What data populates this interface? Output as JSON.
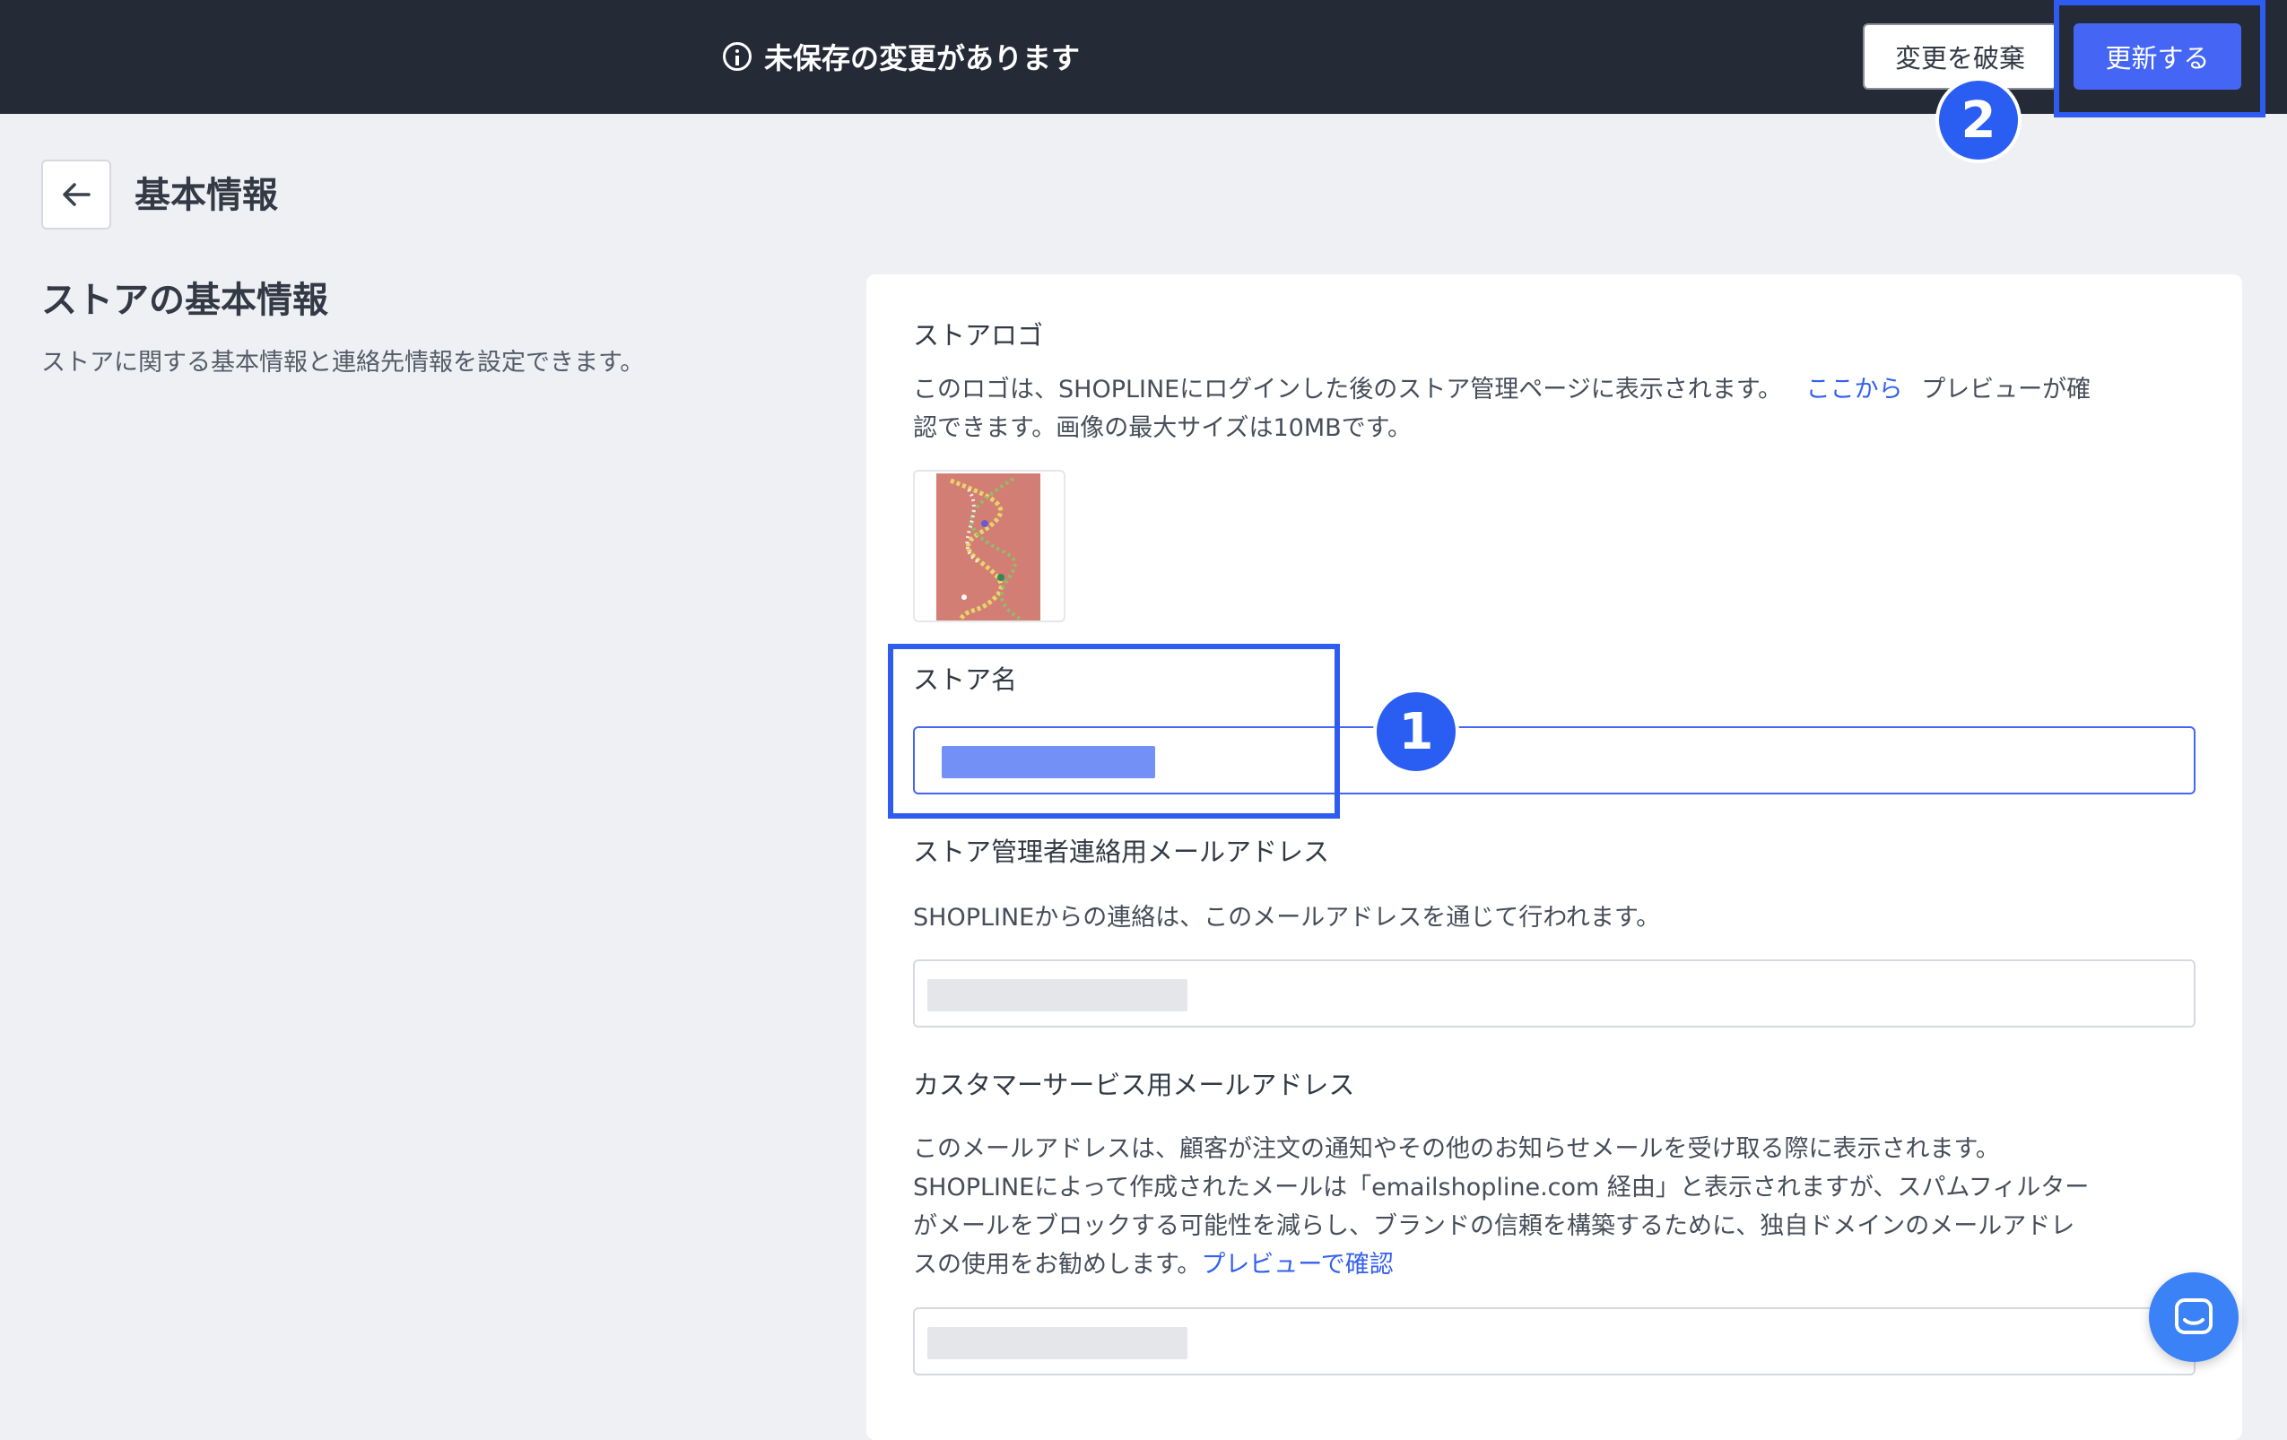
{
  "topbar": {
    "unsaved_message": "未保存の変更があります",
    "discard_label": "変更を破棄",
    "update_label": "更新する"
  },
  "header": {
    "page_title": "基本情報"
  },
  "section": {
    "title": "ストアの基本情報",
    "description": "ストアに関する基本情報と連絡先情報を設定できます。"
  },
  "logo": {
    "label": "ストアロゴ",
    "desc_before_link": "このロゴは、SHOPLINEにログインした後のストア管理ページに表示されます。",
    "link_text": "ここから",
    "desc_after_link_line1": "プレビューが確",
    "desc_line2": "認できます。画像の最大サイズは10MBです。"
  },
  "store_name": {
    "label": "ストア名"
  },
  "admin_email": {
    "label": "ストア管理者連絡用メールアドレス",
    "description": "SHOPLINEからの連絡は、このメールアドレスを通じて行われます。"
  },
  "cs_email": {
    "label": "カスタマーサービス用メールアドレス",
    "desc_line1": "このメールアドレスは、顧客が注文の通知やその他のお知らせメールを受け取る際に表示されます。",
    "desc_line2": "SHOPLINEによって作成されたメールは「emailshopline.com 経由」と表示されますが、スパムフィルター",
    "desc_line3": "がメールをブロックする可能性を減らし、ブランドの信頼を構築するために、独自ドメインのメールアドレ",
    "desc_line4": "スの使用をお勧めします。",
    "link_text": "プレビューで確認"
  },
  "annotations": {
    "step1": "1",
    "step2": "2"
  },
  "colors": {
    "topbar": "#252a37",
    "primary": "#4566f4",
    "annotation": "#2f5cf0",
    "link": "#3560f0",
    "page_bg": "#eef0f4"
  }
}
